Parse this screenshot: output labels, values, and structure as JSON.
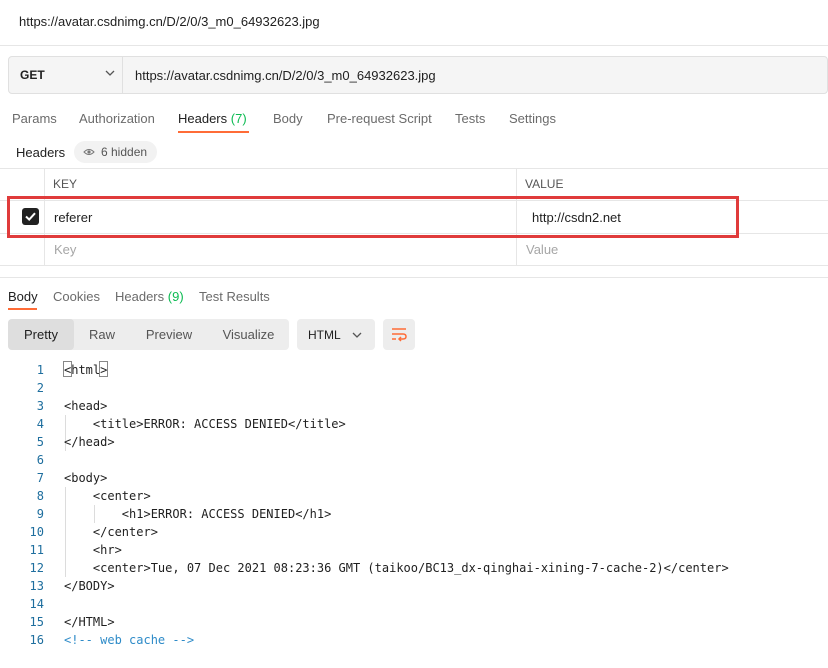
{
  "window": {
    "title": "https://avatar.csdnimg.cn/D/2/0/3_m0_64932623.jpg"
  },
  "request": {
    "method": "GET",
    "url": "https://avatar.csdnimg.cn/D/2/0/3_m0_64932623.jpg"
  },
  "request_tabs": {
    "params": "Params",
    "authorization": "Authorization",
    "headers": "Headers",
    "headers_count": "(7)",
    "body": "Body",
    "pre_request": "Pre-request Script",
    "tests": "Tests",
    "settings": "Settings",
    "active": "headers"
  },
  "headers_section": {
    "label": "Headers",
    "hidden": "6 hidden"
  },
  "headers_table": {
    "col_key": "KEY",
    "col_value": "VALUE",
    "rows": [
      {
        "checked": true,
        "key": "referer",
        "value": "http://csdn2.net"
      }
    ],
    "key_placeholder": "Key",
    "value_placeholder": "Value"
  },
  "response_tabs": {
    "body": "Body",
    "cookies": "Cookies",
    "headers": "Headers",
    "headers_count": "(9)",
    "test_results": "Test Results",
    "active": "body"
  },
  "view_modes": {
    "pretty": "Pretty",
    "raw": "Raw",
    "preview": "Preview",
    "visualize": "Visualize",
    "active": "pretty"
  },
  "language": "HTML",
  "code_lines": [
    {
      "n": "1",
      "text": "<html>"
    },
    {
      "n": "2",
      "text": ""
    },
    {
      "n": "3",
      "text": "<head>"
    },
    {
      "n": "4",
      "text": "    <title>ERROR: ACCESS DENIED</title>"
    },
    {
      "n": "5",
      "text": "</head>"
    },
    {
      "n": "6",
      "text": ""
    },
    {
      "n": "7",
      "text": "<body>"
    },
    {
      "n": "8",
      "text": "    <center>"
    },
    {
      "n": "9",
      "text": "        <h1>ERROR: ACCESS DENIED</h1>"
    },
    {
      "n": "10",
      "text": "    </center>"
    },
    {
      "n": "11",
      "text": "    <hr>"
    },
    {
      "n": "12",
      "text": "    <center>Tue, 07 Dec 2021 08:23:36 GMT (taikoo/BC13_dx-qinghai-xining-7-cache-2)</center>"
    },
    {
      "n": "13",
      "text": "</BODY>"
    },
    {
      "n": "14",
      "text": ""
    },
    {
      "n": "15",
      "text": "</HTML>"
    },
    {
      "n": "16",
      "text": "<!-- web cache -->"
    }
  ],
  "colors": {
    "accent": "#ff6c37",
    "count_green": "#0cbb52",
    "highlight_red": "#e03b3b",
    "line_number": "#1e6e9e",
    "comment": "#2e8bc8"
  }
}
